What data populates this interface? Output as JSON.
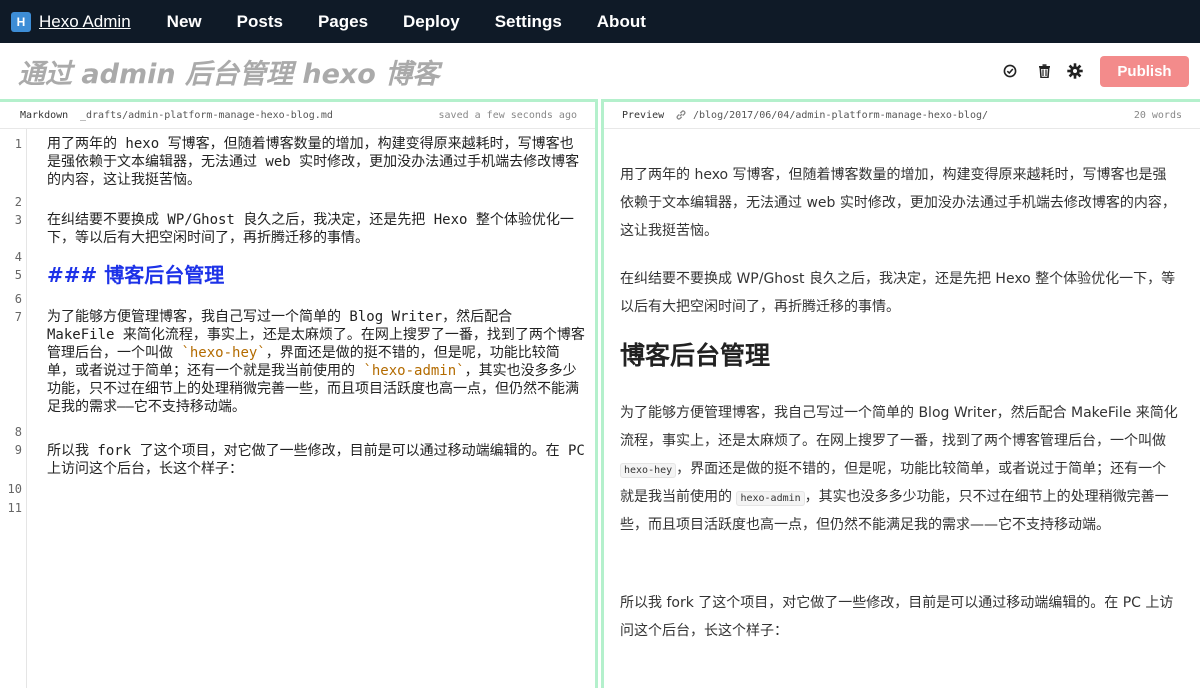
{
  "nav": {
    "logo": "H",
    "brand": "Hexo Admin",
    "items": [
      "New",
      "Posts",
      "Pages",
      "Deploy",
      "Settings",
      "About"
    ]
  },
  "titlebar": {
    "title": "通过 admin 后台管理 hexo 博客",
    "publish_label": "Publish"
  },
  "icons": {
    "check": "check-circle-icon",
    "trash": "trash-icon",
    "gear": "gear-icon",
    "link": "link-icon"
  },
  "colors": {
    "nav_bg": "#0f1a27",
    "publish_bg": "#f38b8b",
    "pane_border": "#b4f0cc",
    "heading_blue": "#1d32e8",
    "code_tick": "#b36b00"
  },
  "editor": {
    "label": "Markdown",
    "path": "_drafts/admin-platform-manage-hexo-blog.md",
    "status": "saved a few seconds ago",
    "line_numbers": [
      "1",
      "2",
      "3",
      "4",
      "5",
      "6",
      "7",
      "8",
      "9",
      "10",
      "11"
    ],
    "p1": "用了两年的 hexo 写博客，但随着博客数量的增加，构建变得原来越耗时，写博客也是强依赖于文本编辑器，无法通过 web 实时修改，更加没办法通过手机端去修改博客的内容，这让我挺苦恼。",
    "p2": "在纠结要不要换成 WP/Ghost 良久之后，我决定，还是先把 Hexo 整个体验优化一下，等以后有大把空闲时间了，再折腾迁移的事情。",
    "h3": "### 博客后台管理",
    "p3_a": "为了能够方便管理博客，我自己写过一个简单的 Blog Writer，然后配合 MakeFile 来简化流程，事实上，还是太麻烦了。在网上搜罗了一番，找到了两个博客管理后台，一个叫做 ",
    "p3_code1": "`hexo-hey`",
    "p3_b": "，界面还是做的挺不错的，但是呢，功能比较简单，或者说过于简单；还有一个就是我当前使用的 ",
    "p3_code2": "`hexo-admin`",
    "p3_c": "，其实也没多多少功能，只不过在细节上的处理稍微完善一些，而且项目活跃度也高一点，但仍然不能满足我的需求——它不支持移动端。",
    "p4": "所以我 fork 了这个项目，对它做了一些修改，目前是可以通过移动端编辑的。在 PC 上访问这个后台，长这个样子："
  },
  "preview": {
    "label": "Preview",
    "path": "/blog/2017/06/04/admin-platform-manage-hexo-blog/",
    "word_count": "20 words",
    "p1": "用了两年的 hexo 写博客，但随着博客数量的增加，构建变得原来越耗时，写博客也是强依赖于文本编辑器，无法通过 web 实时修改，更加没办法通过手机端去修改博客的内容，这让我挺苦恼。",
    "p2": "在纠结要不要换成 WP/Ghost 良久之后，我决定，还是先把 Hexo 整个体验优化一下，等以后有大把空闲时间了，再折腾迁移的事情。",
    "h": "博客后台管理",
    "p3_a": "为了能够方便管理博客，我自己写过一个简单的 Blog Writer，然后配合 MakeFile 来简化流程，事实上，还是太麻烦了。在网上搜罗了一番，找到了两个博客管理后台，一个叫做 ",
    "p3_code1": "hexo-hey",
    "p3_b": "，界面还是做的挺不错的，但是呢，功能比较简单，或者说过于简单；还有一个就是我当前使用的 ",
    "p3_code2": "hexo-admin",
    "p3_c": "，其实也没多多少功能，只不过在细节上的处理稍微完善一些，而且项目活跃度也高一点，但仍然不能满足我的需求——它不支持移动端。",
    "p4": "所以我 fork 了这个项目，对它做了一些修改，目前是可以通过移动端编辑的。在 PC 上访问这个后台，长这个样子："
  }
}
